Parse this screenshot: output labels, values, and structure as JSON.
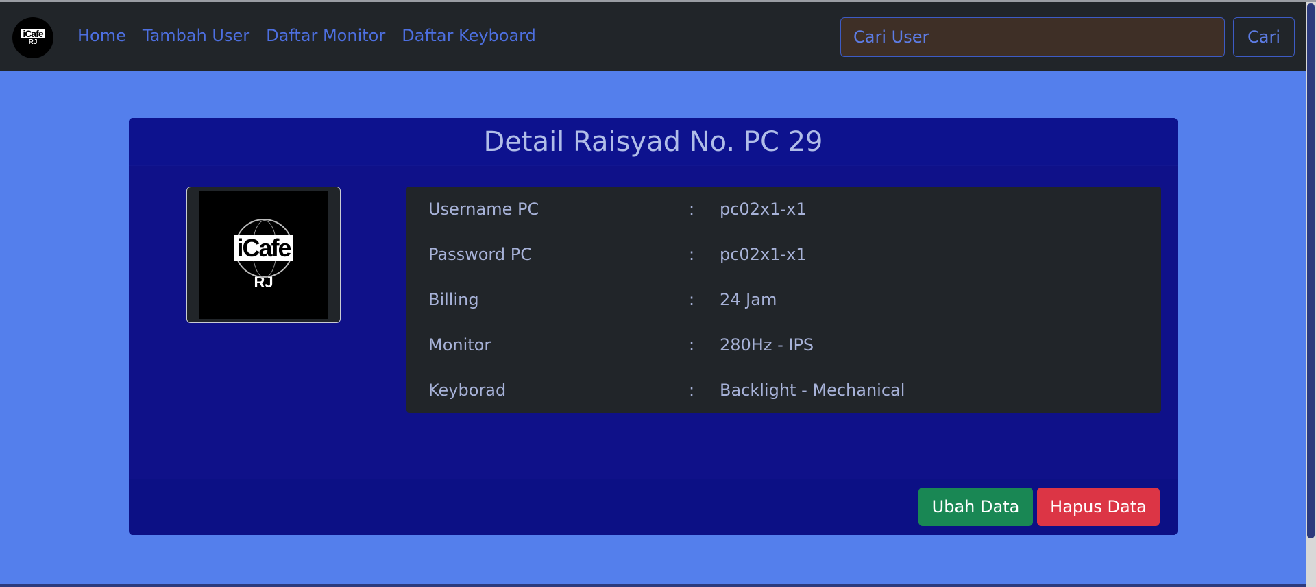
{
  "navbar": {
    "brand": {
      "line1": "iCafe",
      "line2": "RJ"
    },
    "links": [
      "Home",
      "Tambah User",
      "Daftar Monitor",
      "Daftar Keyboard"
    ],
    "search_placeholder": "Cari User",
    "search_button": "Cari"
  },
  "detail": {
    "title": "Detail Raisyad No. PC 29",
    "photo": {
      "line1": "iCafe",
      "line2": "RJ"
    },
    "separator": ":",
    "rows": [
      {
        "label": "Username PC",
        "value": "pc02x1-x1"
      },
      {
        "label": "Password PC",
        "value": "pc02x1-x1"
      },
      {
        "label": "Billing",
        "value": "24 Jam"
      },
      {
        "label": "Monitor",
        "value": "280Hz - IPS"
      },
      {
        "label": "Keyborad",
        "value": "Backlight - Mechanical"
      }
    ],
    "edit_button": "Ubah Data",
    "delete_button": "Hapus Data"
  },
  "colors": {
    "page_bg": "#547fec",
    "navbar_bg": "#212529",
    "card_bg": "#0f1189",
    "edit": "#198754",
    "delete": "#dc3545"
  }
}
